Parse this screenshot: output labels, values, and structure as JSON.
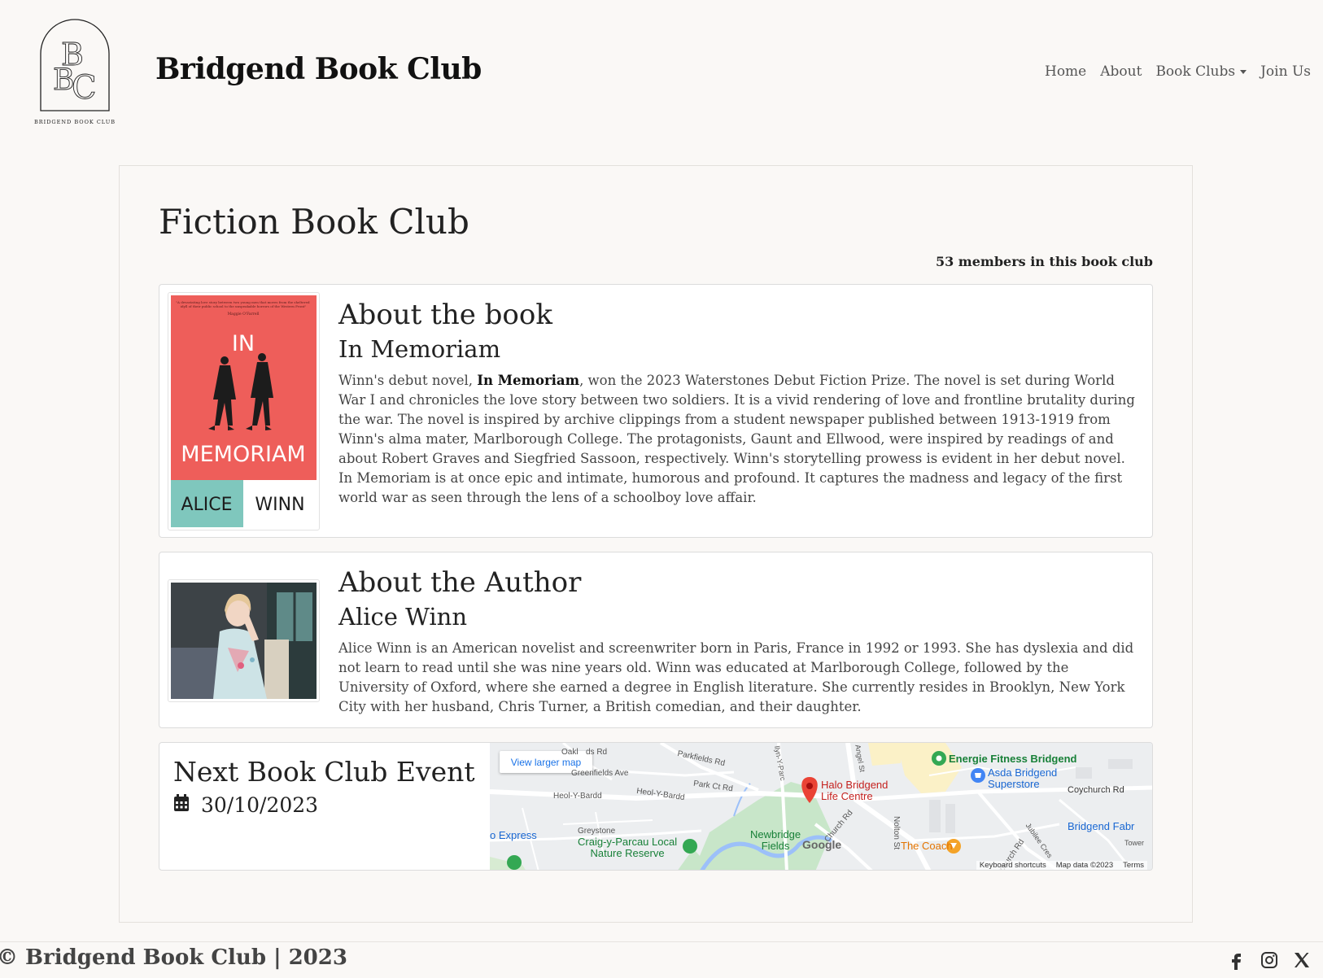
{
  "header": {
    "logo_letters": "BBC",
    "logo_caption": "BRIDGEND BOOK CLUB",
    "site_title": "Bridgend Book Club",
    "nav": [
      "Home",
      "About",
      "Book Clubs",
      "Join Us"
    ]
  },
  "main": {
    "title": "Fiction Book Club",
    "members": "53 members in this book club",
    "book": {
      "heading": "About the book",
      "title": "In Memoriam",
      "cover": {
        "quote": "\"A devastating love story between two young men that moves from the sheltered idyll of their public school to the unspeakable horrors of the Western Front\"",
        "quote_author": "Maggie O'Farrell",
        "word_top": "IN",
        "word_bottom": "MEMORIAM",
        "author_first": "ALICE",
        "author_last": "WINN"
      },
      "desc_before": "Winn's debut novel, ",
      "desc_bold": "In Memoriam",
      "desc_after": ", won the 2023 Waterstones Debut Fiction Prize. The novel is set during World War I and chronicles the love story between two soldiers. It is a vivid rendering of love and frontline brutality during the war. The novel is inspired by archive clippings from a student newspaper published between 1913-1919 from Winn's alma mater, Marlborough College. The protagonists, Gaunt and Ellwood, were inspired by readings of and about Robert Graves and Siegfried Sassoon, respectively. Winn's storytelling prowess is evident in her debut novel. In Memoriam is at once epic and intimate, humorous and profound. It captures the madness and legacy of the first world war as seen through the lens of a schoolboy love affair."
    },
    "author": {
      "heading": "About the Author",
      "name": "Alice Winn",
      "desc": "Alice Winn is an American novelist and screenwriter born in Paris, France in 1992 or 1993. She has dyslexia and did not learn to read until she was nine years old. Winn was educated at Marlborough College, followed by the University of Oxford, where she earned a degree in English literature. She currently resides in Brooklyn, New York City with her husband, Chris Turner, a British comedian, and their daughter."
    },
    "event": {
      "title": "Next Book Club Event",
      "date": "30/10/2023",
      "map": {
        "view_larger": "View larger map",
        "places": {
          "halo_1": "Halo Bridgend",
          "halo_2": "Life Centre",
          "energie": "Energie Fitness Bridgend",
          "asda_1": "Asda Bridgend",
          "asda_2": "Superstore",
          "coach": "The Coach",
          "craig_1": "Craig-y-Parcau Local",
          "craig_2": "Nature Reserve",
          "newbridge_1": "Newbridge",
          "newbridge_2": "Fields",
          "fabr": "Bridgend Fabr",
          "express": "o Express"
        },
        "streets": {
          "oakl": "Oakl",
          "ds_rd": "ds Rd",
          "greenfields": "Greenfields Ave",
          "parkfields": "Parkfields Rd",
          "heol_y_bardd_1": "Heol-Y-Bardd",
          "heol_y_bardd_2": "Heol-Y-Bardd",
          "park_ct": "Park Ct Rd",
          "greystone": "Greystone",
          "church_rd": "Church Rd",
          "nolton": "Nolton St",
          "coychurch": "Coychurch Rd",
          "ychurch": "ychurch Rd",
          "jubilee": "Jubilee Cres",
          "tower": "Tower",
          "y_parc": "llyn-Y-Parc",
          "angel": "Angel St"
        },
        "google": "Google",
        "keyboard": "Keyboard shortcuts",
        "mapdata": "Map data ©2023",
        "terms": "Terms"
      }
    }
  },
  "footer": {
    "text": "© Bridgend Book Club | 2023",
    "socials": [
      "facebook-icon",
      "instagram-icon",
      "x-icon"
    ]
  },
  "colors": {
    "background": "#faf8f6",
    "cover_red": "#ee5e5a",
    "cover_teal": "#7fc7bd",
    "map_pin": "#ea4335"
  }
}
